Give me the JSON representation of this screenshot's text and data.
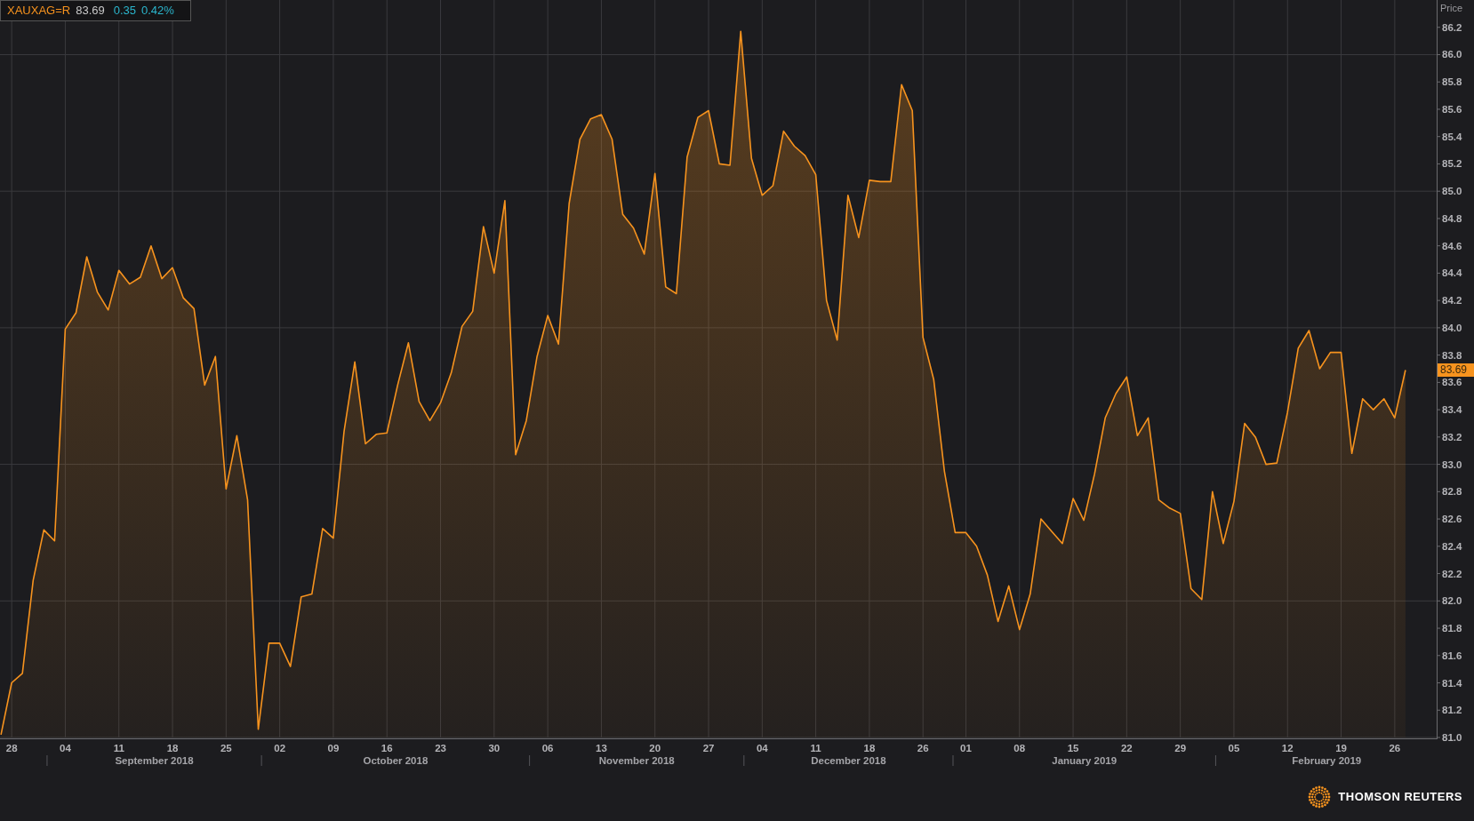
{
  "legend": {
    "last": "83.69",
    "change": "0.35",
    "change_pct": "0.42%"
  },
  "price_axis_title": "Price",
  "last_price_tag": "83.69",
  "chart_data": {
    "type": "area",
    "grid": true,
    "ylim": [
      81.0,
      86.4
    ],
    "categories": [
      null,
      "28",
      null,
      null,
      null,
      null,
      "04",
      null,
      null,
      null,
      null,
      "11",
      null,
      null,
      null,
      null,
      "18",
      null,
      null,
      null,
      null,
      "25",
      null,
      null,
      null,
      null,
      "02",
      null,
      null,
      null,
      null,
      "09",
      null,
      null,
      null,
      null,
      "16",
      null,
      null,
      null,
      null,
      "23",
      null,
      null,
      null,
      null,
      "30",
      null,
      null,
      null,
      null,
      "06",
      null,
      null,
      null,
      null,
      "13",
      null,
      null,
      null,
      null,
      "20",
      null,
      null,
      null,
      null,
      "27",
      null,
      null,
      null,
      null,
      "04",
      null,
      null,
      null,
      null,
      "11",
      null,
      null,
      null,
      null,
      "18",
      null,
      null,
      null,
      null,
      "26",
      null,
      null,
      null,
      "01",
      null,
      null,
      null,
      null,
      "08",
      null,
      null,
      null,
      null,
      "15",
      null,
      null,
      null,
      null,
      "22",
      null,
      null,
      null,
      null,
      "29",
      null,
      null,
      null,
      null,
      "05",
      null,
      null,
      null,
      null,
      "12",
      null,
      null,
      null,
      null,
      "19",
      null,
      null,
      null,
      null,
      "26",
      null
    ],
    "series": [
      {
        "name": "XAUXAG=R",
        "color": "#f7931e",
        "values": [
          81.02,
          81.4,
          81.47,
          82.15,
          82.52,
          82.44,
          83.99,
          84.11,
          84.52,
          84.26,
          84.13,
          84.42,
          84.32,
          84.37,
          84.6,
          84.36,
          84.44,
          84.22,
          84.14,
          83.58,
          83.79,
          82.82,
          83.21,
          82.74,
          81.06,
          81.69,
          81.69,
          81.52,
          82.03,
          82.05,
          82.53,
          82.46,
          83.24,
          83.75,
          83.15,
          83.22,
          83.23,
          83.58,
          83.89,
          83.46,
          83.32,
          83.45,
          83.67,
          84.01,
          84.12,
          84.74,
          84.4,
          84.93,
          83.07,
          83.32,
          83.79,
          84.09,
          83.88,
          84.91,
          85.38,
          85.53,
          85.56,
          85.38,
          84.83,
          84.73,
          84.54,
          85.13,
          84.3,
          84.25,
          85.25,
          85.54,
          85.59,
          85.2,
          85.19,
          86.17,
          85.24,
          84.97,
          85.04,
          85.44,
          85.33,
          85.26,
          85.12,
          84.2,
          83.91,
          84.97,
          84.66,
          85.08,
          85.07,
          85.07,
          85.78,
          85.59,
          83.93,
          83.62,
          82.95,
          82.5,
          82.5,
          82.4,
          82.19,
          81.85,
          82.11,
          81.79,
          82.05,
          82.6,
          82.51,
          82.42,
          82.75,
          82.59,
          82.93,
          83.34,
          83.52,
          83.64,
          83.21,
          83.34,
          82.74,
          82.68,
          82.64,
          82.09,
          82.01,
          82.8,
          82.42,
          82.73,
          83.3,
          83.2,
          83.0,
          83.01,
          83.38,
          83.85,
          83.98,
          83.7,
          83.82,
          83.82,
          83.08,
          83.48,
          83.4,
          83.48,
          83.34,
          83.69
        ]
      }
    ],
    "yticks": [
      {
        "value": 81.0,
        "label": "81.0"
      },
      {
        "value": 81.2,
        "label": "81.2"
      },
      {
        "value": 81.4,
        "label": "81.4"
      },
      {
        "value": 81.6,
        "label": "81.6"
      },
      {
        "value": 81.8,
        "label": "81.8"
      },
      {
        "value": 82.0,
        "label": "82.0"
      },
      {
        "value": 82.2,
        "label": "82.2"
      },
      {
        "value": 82.4,
        "label": "82.4"
      },
      {
        "value": 82.6,
        "label": "82.6"
      },
      {
        "value": 82.8,
        "label": "82.8"
      },
      {
        "value": 83.0,
        "label": "83.0"
      },
      {
        "value": 83.2,
        "label": "83.2"
      },
      {
        "value": 83.4,
        "label": "83.4"
      },
      {
        "value": 83.6,
        "label": "83.6"
      },
      {
        "value": 83.8,
        "label": "83.8"
      },
      {
        "value": 84.0,
        "label": "84.0"
      },
      {
        "value": 84.2,
        "label": "84.2"
      },
      {
        "value": 84.4,
        "label": "84.4"
      },
      {
        "value": 84.6,
        "label": "84.6"
      },
      {
        "value": 84.8,
        "label": "84.8"
      },
      {
        "value": 85.0,
        "label": "85.0"
      },
      {
        "value": 85.2,
        "label": "85.2"
      },
      {
        "value": 85.4,
        "label": "85.4"
      },
      {
        "value": 85.6,
        "label": "85.6"
      },
      {
        "value": 85.8,
        "label": "85.8"
      },
      {
        "value": 86.0,
        "label": "86.0"
      },
      {
        "value": 86.2,
        "label": "86.2"
      }
    ],
    "annotations": [
      "September 2018",
      "October 2018",
      "November 2018",
      "December 2018",
      "January 2019",
      "February 2019"
    ]
  },
  "brand": "THOMSON REUTERS"
}
